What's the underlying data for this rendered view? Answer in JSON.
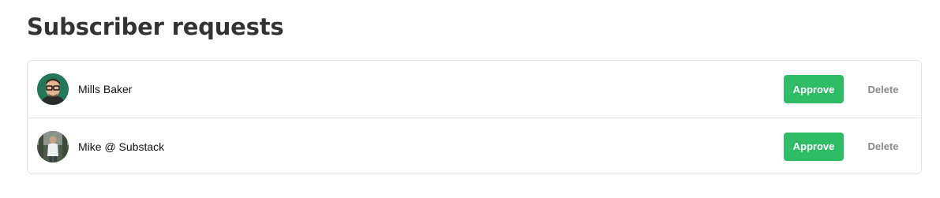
{
  "page": {
    "title": "Subscriber requests"
  },
  "requests": [
    {
      "name": "Mills Baker",
      "avatar": "avatar-photo-man-glasses-green",
      "approve_label": "Approve",
      "delete_label": "Delete"
    },
    {
      "name": "Mike @ Substack",
      "avatar": "avatar-photo-man-outdoors",
      "approve_label": "Approve",
      "delete_label": "Delete"
    }
  ],
  "colors": {
    "approve_bg": "#2ebd66",
    "approve_text": "#ffffff",
    "delete_text": "#8a8a8a",
    "title_text": "#333333",
    "border": "#e2e2e2"
  }
}
